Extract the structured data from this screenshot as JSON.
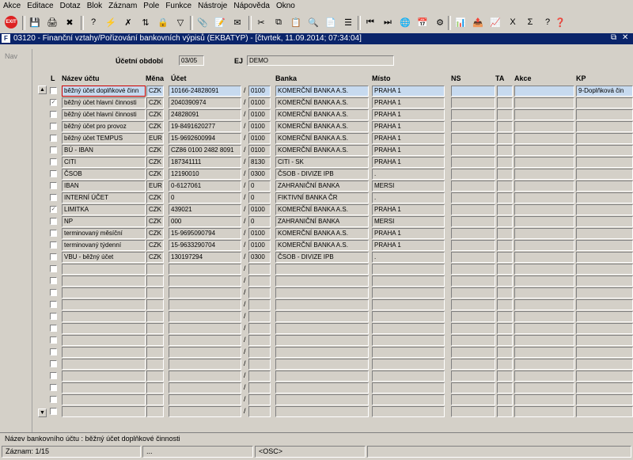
{
  "menu": [
    "Akce",
    "Editace",
    "Dotaz",
    "Blok",
    "Záznam",
    "Pole",
    "Funkce",
    "Nástroje",
    "Nápověda",
    "Okno"
  ],
  "toolbar": {
    "exit_label": "EXIT"
  },
  "window": {
    "title": "03120 - Finanční vztahy/Pořizování bankovních výpisů (EKBATYP) - [čtvrtek, 11.09.2014; 07:34:04]",
    "icon_text": "F"
  },
  "nav": {
    "label": "Nav"
  },
  "form": {
    "ucetni_obdobi_label": "Účetní období",
    "ucetni_obdobi_value": "03/05",
    "ej_label": "EJ",
    "ej_value": "DEMO"
  },
  "columns": {
    "l": "L",
    "nazev": "Název účtu",
    "mena": "Měna",
    "ucet": "Účet",
    "banka": "Banka",
    "misto": "Místo",
    "ns": "NS",
    "ta": "TA",
    "akce": "Akce",
    "kp": "KP"
  },
  "rows": [
    {
      "nazev": "běžný účet doplňkové činn",
      "mena": "CZK",
      "ucet": "10166-24828091",
      "kod": "0100",
      "banka": "KOMERČNÍ BANKA A.S.",
      "misto": "PRAHA 1",
      "ns": "",
      "ta": "",
      "akce": "",
      "kp": "9-Doplňková čin",
      "checked": ""
    },
    {
      "nazev": "běžný účet hlavní činnosti",
      "mena": "CZK",
      "ucet": "2040390974",
      "kod": "0100",
      "banka": "KOMERČNÍ BANKA A.S.",
      "misto": "PRAHA 1",
      "ns": "",
      "ta": "",
      "akce": "",
      "kp": "",
      "checked": "✓"
    },
    {
      "nazev": "běžný účet hlavní činnosti",
      "mena": "CZK",
      "ucet": "24828091",
      "kod": "0100",
      "banka": "KOMERČNÍ BANKA A.S.",
      "misto": "PRAHA 1",
      "ns": "",
      "ta": "",
      "akce": "",
      "kp": "",
      "checked": ""
    },
    {
      "nazev": "běžný účet pro provoz",
      "mena": "CZK",
      "ucet": "19-8491620277",
      "kod": "0100",
      "banka": "KOMERČNÍ BANKA A.S.",
      "misto": "PRAHA 1",
      "ns": "",
      "ta": "",
      "akce": "",
      "kp": "",
      "checked": ""
    },
    {
      "nazev": "běžný účet TEMPUS",
      "mena": "EUR",
      "ucet": "15-9692600994",
      "kod": "0100",
      "banka": "KOMERČNÍ BANKA A.S.",
      "misto": "PRAHA 1",
      "ns": "",
      "ta": "",
      "akce": "",
      "kp": "",
      "checked": ""
    },
    {
      "nazev": "BÚ - IBAN",
      "mena": "CZK",
      "ucet": "CZ86 0100 2482 8091",
      "kod": "0100",
      "banka": "KOMERČNÍ BANKA A.S.",
      "misto": "PRAHA 1",
      "ns": "",
      "ta": "",
      "akce": "",
      "kp": "",
      "checked": ""
    },
    {
      "nazev": "CITI",
      "mena": "CZK",
      "ucet": "187341111",
      "kod": "8130",
      "banka": "CITI - SK",
      "misto": "PRAHA 1",
      "ns": "",
      "ta": "",
      "akce": "",
      "kp": "",
      "checked": ""
    },
    {
      "nazev": "ČSOB",
      "mena": "CZK",
      "ucet": "12190010",
      "kod": "0300",
      "banka": "ČSOB - DIVIZE IPB",
      "misto": ".",
      "ns": "",
      "ta": "",
      "akce": "",
      "kp": "",
      "checked": ""
    },
    {
      "nazev": "IBAN",
      "mena": "EUR",
      "ucet": "0-6127061",
      "kod": "0",
      "banka": "ZAHRANIČNÍ BANKA",
      "misto": "MERSI",
      "ns": "",
      "ta": "",
      "akce": "",
      "kp": "",
      "checked": ""
    },
    {
      "nazev": "INTERNÍ ÚČET",
      "mena": "CZK",
      "ucet": "0",
      "kod": "0",
      "banka": "FIKTIVNÍ BANKA ČR",
      "misto": ".",
      "ns": "",
      "ta": "",
      "akce": "",
      "kp": "",
      "checked": ""
    },
    {
      "nazev": "LIMITKA",
      "mena": "CZK",
      "ucet": "439021",
      "kod": "0100",
      "banka": "KOMERČNÍ BANKA A.S.",
      "misto": "PRAHA 1",
      "ns": "",
      "ta": "",
      "akce": "",
      "kp": "",
      "checked": "✓"
    },
    {
      "nazev": "NP",
      "mena": "CZK",
      "ucet": "000",
      "kod": "0",
      "banka": "ZAHRANIČNÍ BANKA",
      "misto": "MERSI",
      "ns": "",
      "ta": "",
      "akce": "",
      "kp": "",
      "checked": ""
    },
    {
      "nazev": "terminovaný měsíční",
      "mena": "CZK",
      "ucet": "15-9695090794",
      "kod": "0100",
      "banka": "KOMERČNÍ BANKA A.S.",
      "misto": "PRAHA 1",
      "ns": "",
      "ta": "",
      "akce": "",
      "kp": "",
      "checked": ""
    },
    {
      "nazev": "terminovaný týdenní",
      "mena": "CZK",
      "ucet": "15-9633290704",
      "kod": "0100",
      "banka": "KOMERČNÍ BANKA A.S.",
      "misto": "PRAHA 1",
      "ns": "",
      "ta": "",
      "akce": "",
      "kp": "",
      "checked": ""
    },
    {
      "nazev": "VBU - běžný účet",
      "mena": "CZK",
      "ucet": "130197294",
      "kod": "0300",
      "banka": "ČSOB - DIVIZE IPB",
      "misto": ".",
      "ns": "",
      "ta": "",
      "akce": "",
      "kp": "",
      "checked": ""
    }
  ],
  "empty_row_slash": "/",
  "status": {
    "field_hint": "Název bankovního účtu : běžný účet doplňkové činnosti",
    "record": "Záznam: 1/15",
    "dots": "...",
    "mode": "<OSC>"
  }
}
